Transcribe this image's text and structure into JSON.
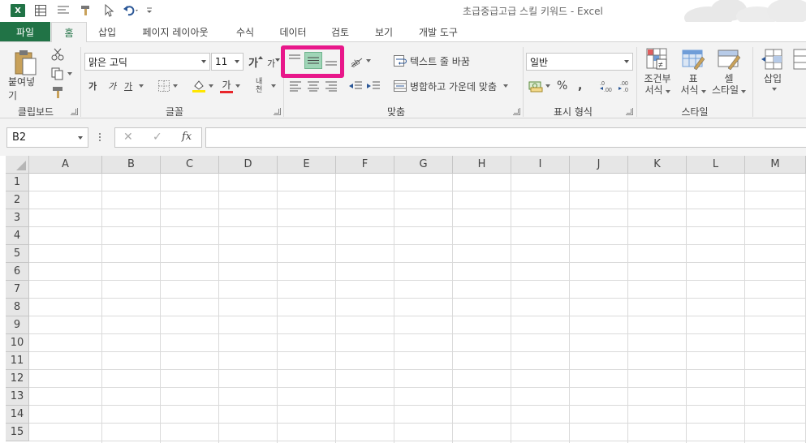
{
  "window": {
    "title": "초급중급고급 스킬 키워드 - Excel",
    "app_logo": "X"
  },
  "quick_access": {
    "icons": [
      "excel-logo-icon",
      "form-icon",
      "align-icon",
      "format-painter-icon",
      "pointer-icon",
      "undo-icon",
      "customize-icon"
    ]
  },
  "tabs": {
    "file": "파일",
    "home": "홈",
    "insert": "삽입",
    "page_layout": "페이지 레이아웃",
    "formulas": "수식",
    "data": "데이터",
    "review": "검토",
    "view": "보기",
    "developer": "개발 도구"
  },
  "ribbon": {
    "clipboard": {
      "paste": "붙여넣기",
      "label": "클립보드"
    },
    "font": {
      "name": "맑은 고딕",
      "size": "11",
      "grow": "가",
      "shrink": "가",
      "bold": "가",
      "italic": "가",
      "underline": "가",
      "font_color": "가",
      "phonetic": "내천",
      "label": "글꼴"
    },
    "alignment": {
      "wrap_text": "텍스트 줄 바꿈",
      "merge_center": "병합하고 가운데 맞춤",
      "label": "맞춤",
      "selected": "middle-align"
    },
    "number": {
      "format": "일반",
      "percent": "%",
      "comma": ",",
      "label": "표시 형식"
    },
    "styles": {
      "conditional": "조건부",
      "conditional2": "서식",
      "table": "표",
      "table2": "서식",
      "cell": "셀",
      "cell2": "스타일",
      "label": "스타일"
    },
    "cells": {
      "insert": "삽입"
    }
  },
  "formula_bar": {
    "name_box": "B2",
    "cancel": "✕",
    "enter": "✓",
    "fx": "fx",
    "value": ""
  },
  "sheet": {
    "columns": [
      "A",
      "B",
      "C",
      "D",
      "E",
      "F",
      "G",
      "H",
      "I",
      "J",
      "K",
      "L",
      "M"
    ],
    "rows": [
      "1",
      "2",
      "3",
      "4",
      "5",
      "6",
      "7",
      "8",
      "9",
      "10",
      "11",
      "12",
      "13",
      "14",
      "15"
    ]
  },
  "colors": {
    "accent": "#217346",
    "highlight": "#e8178a",
    "selected_button": "#9fd5b7"
  }
}
